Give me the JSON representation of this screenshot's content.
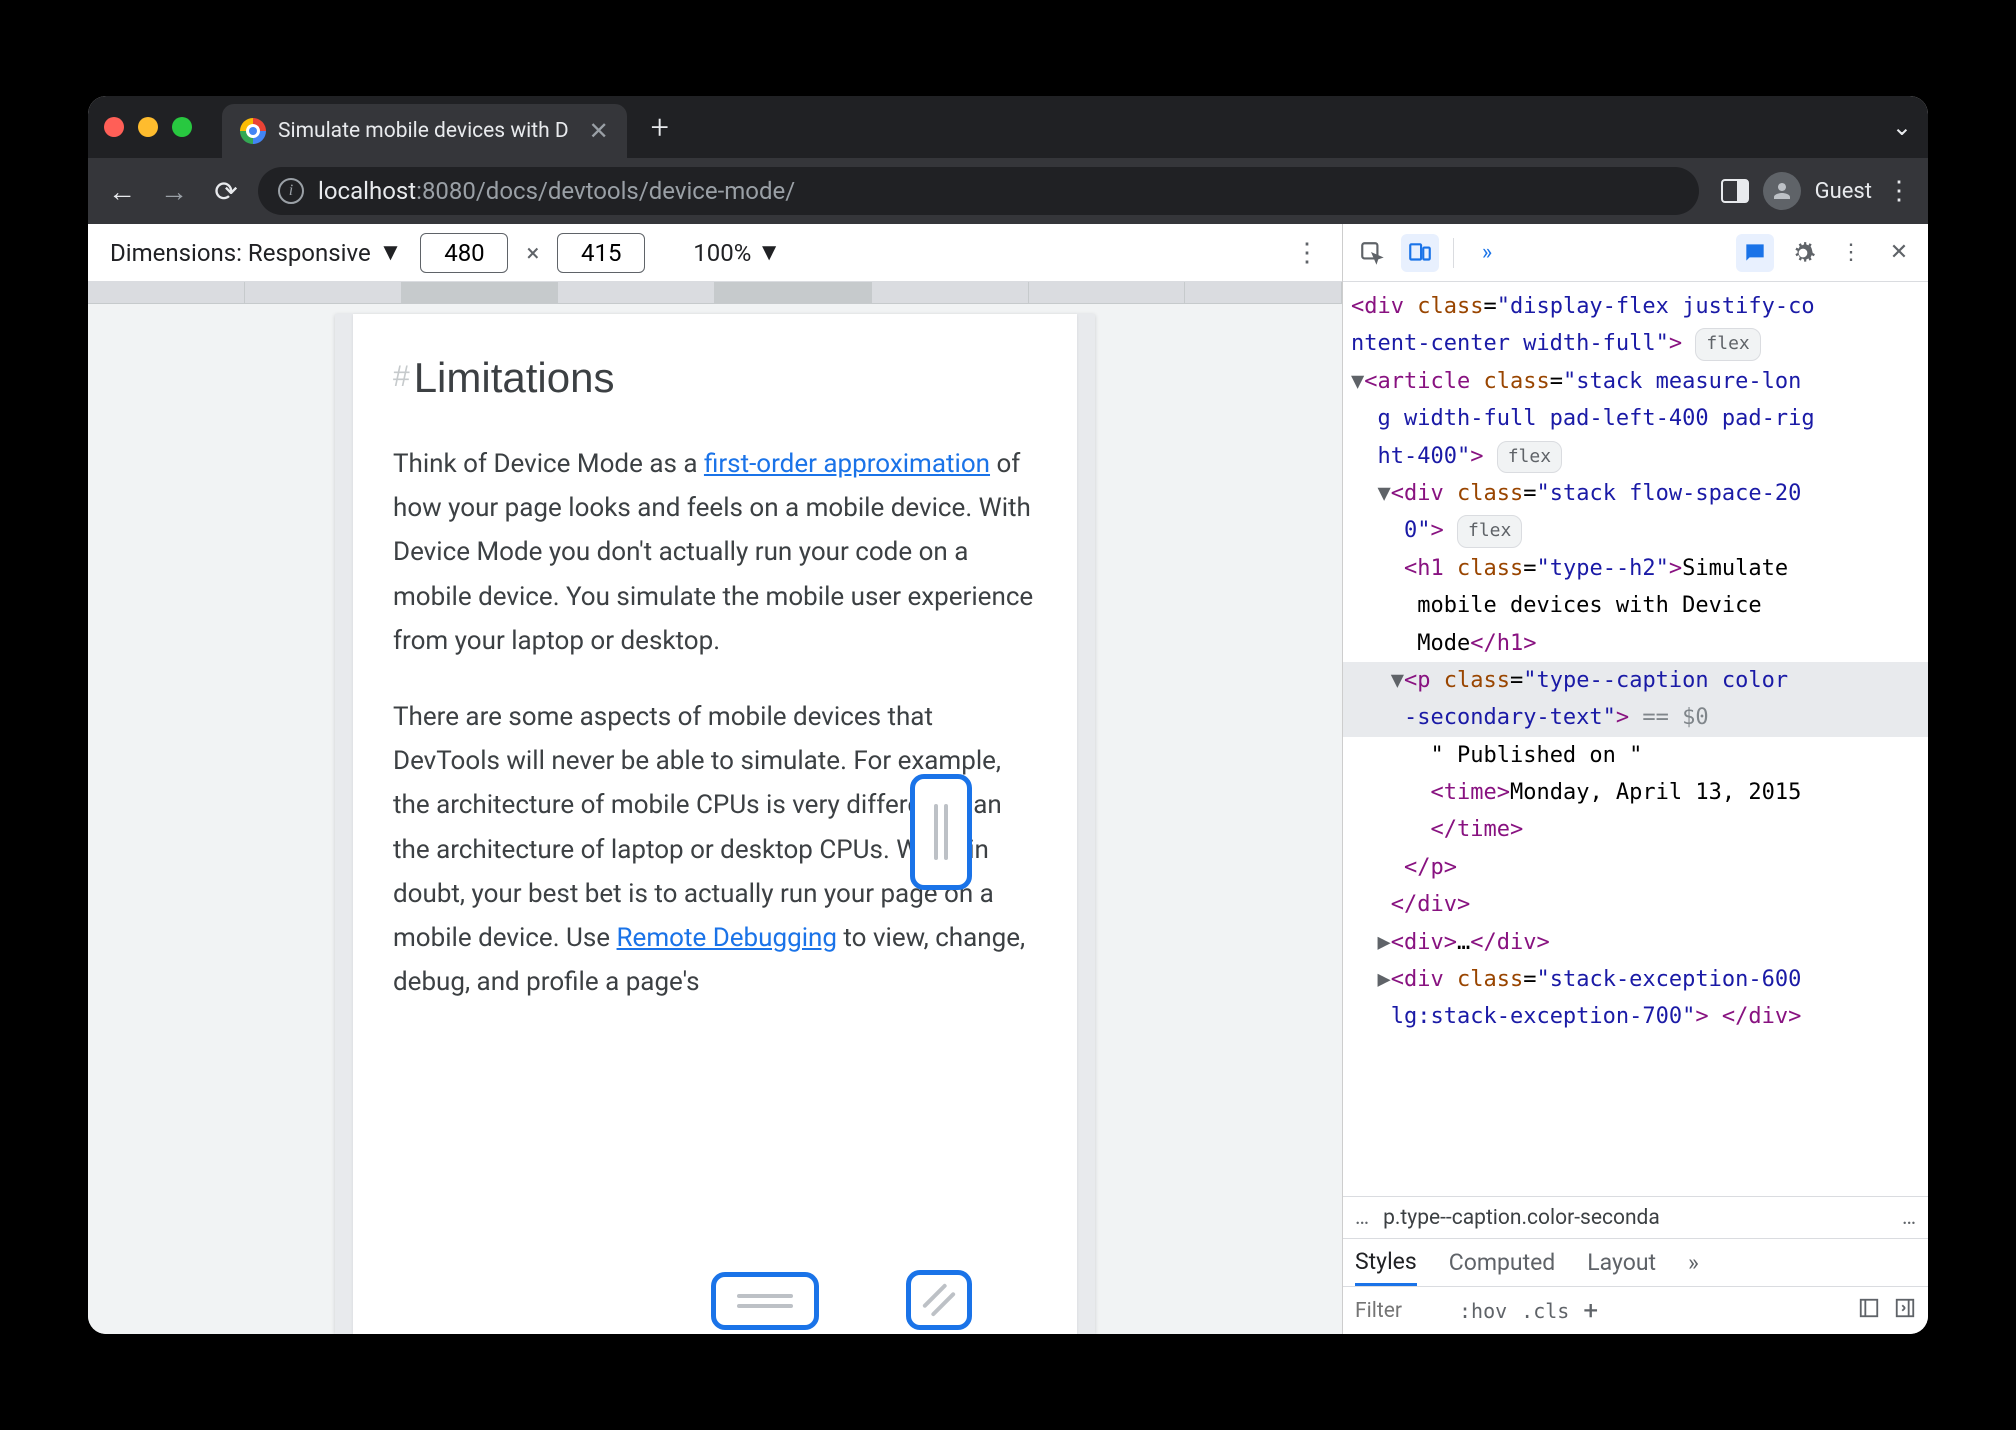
{
  "browser": {
    "tab_title": "Simulate mobile devices with D",
    "profile_label": "Guest",
    "url_host": "localhost",
    "url_port": ":8080",
    "url_path": "/docs/devtools/device-mode/"
  },
  "device_toolbar": {
    "dimensions_label": "Dimensions: Responsive",
    "width": "480",
    "height": "415",
    "zoom": "100%"
  },
  "page": {
    "heading": "Limitations",
    "p1_a": "Think of Device Mode as a ",
    "p1_link": "first-order approximation",
    "p1_b": " of how your page looks and feels on a mobile device. With Device Mode you don't actually run your code on a mobile device. You simulate the mobile user experience from your laptop or desktop.",
    "p2_a": "There are some aspects of mobile devices that DevTools will never be able to simulate. For example, the architecture of mobile CPUs is very different than the architecture of laptop or desktop CPUs. When in doubt, your best bet is to actually run your page on a mobile device. Use ",
    "p2_link": "Remote Debugging",
    "p2_b": " to view, change, debug, and profile a page's"
  },
  "devtools": {
    "elements": {
      "l1": "<div class=\"display-flex justify-co",
      "l1b": "ntent-center width-full\">",
      "flex_badge": "flex",
      "l2": "<article class=\"stack measure-lon",
      "l2b": "g width-full pad-left-400 pad-rig",
      "l2c": "ht-400\">",
      "l3": "<div class=\"stack flow-space-20",
      "l3b": "0\">",
      "l4a": "<h1 class=\"type--h2\">",
      "l4b": "Simulate mobile devices with Device Mode",
      "l4c": "</h1>",
      "l5a": "<p class=\"type--caption color",
      "l5b": "-secondary-text\">",
      "l5c": " == $0",
      "l6": "\" Published on \"",
      "l7a": "<time>",
      "l7b": "Monday, April 13, 2015",
      "l7c": "</time>",
      "l8": "</p>",
      "l9": "</div>",
      "l10a": "<div>",
      "l10b": "…",
      "l10c": "</div>",
      "l11a": "<div class=\"stack-exception-600",
      "l11b": "lg:stack-exception-700\">",
      "l11c": "</div>"
    },
    "crumb": "p.type--caption.color-seconda",
    "styles_tabs": {
      "styles": "Styles",
      "computed": "Computed",
      "layout": "Layout"
    },
    "filter_placeholder": "Filter",
    "hov": ":hov",
    "cls": ".cls"
  }
}
